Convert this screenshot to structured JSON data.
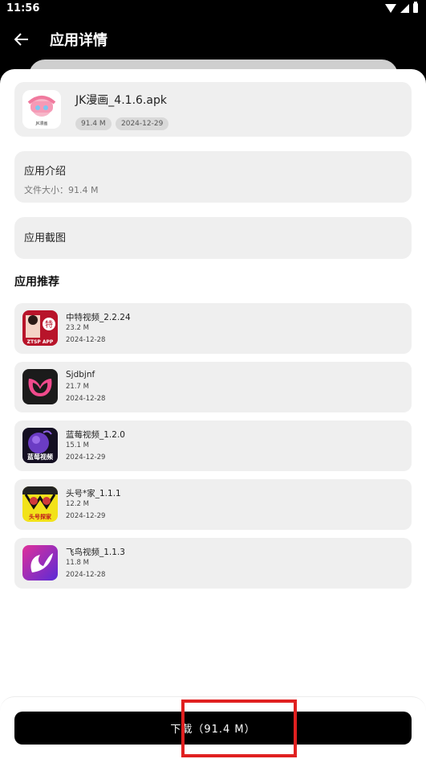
{
  "status_bar": {
    "time": "11:56"
  },
  "app_bar": {
    "title": "应用详情"
  },
  "app": {
    "name": "JK漫画_4.1.6.apk",
    "size": "91.4 M",
    "date": "2024-12-29",
    "icon_caption": "JK漫画"
  },
  "intro": {
    "title": "应用介绍",
    "file_size": "文件大小：91.4 M"
  },
  "screenshots": {
    "title": "应用截图"
  },
  "recommend": {
    "heading": "应用推荐",
    "items": [
      {
        "name": "中特视频_2.2.24",
        "size": "23.2 M",
        "date": "2024-12-28",
        "icon_text": "ZTSP APP"
      },
      {
        "name": "Sjdbjnf",
        "size": "21.7 M",
        "date": "2024-12-28",
        "icon_text": ""
      },
      {
        "name": "蓝莓视频_1.2.0",
        "size": "15.1 M",
        "date": "2024-12-29",
        "icon_text": "蓝莓视频"
      },
      {
        "name": "头号*家_1.1.1",
        "size": "12.2 M",
        "date": "2024-12-29",
        "icon_text": "头号探家"
      },
      {
        "name": "飞鸟视频_1.1.3",
        "size": "11.8 M",
        "date": "2024-12-28",
        "icon_text": ""
      }
    ]
  },
  "download": {
    "label": "下载（91.4 M）"
  },
  "colors": {
    "background": "#000000",
    "card": "#efefef",
    "button": "#000000",
    "highlight": "#e02020"
  },
  "icons": [
    "back-arrow-icon",
    "wifi-icon",
    "signal-icon",
    "battery-icon"
  ]
}
